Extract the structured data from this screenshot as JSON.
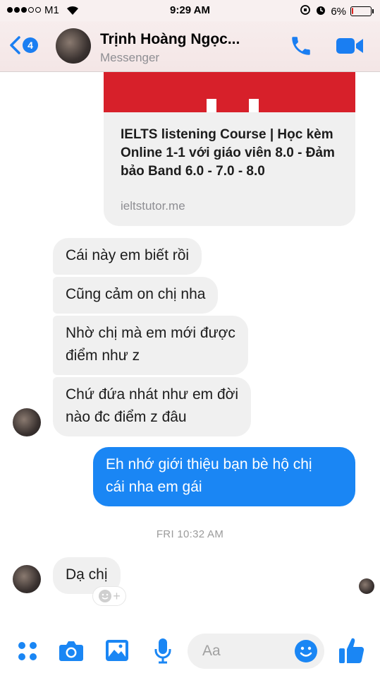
{
  "status_bar": {
    "carrier": "M1",
    "time": "9:29 AM",
    "battery_percent": "6%",
    "battery_level": 0.06,
    "signal_bars_filled": 3,
    "signal_bars_total": 5
  },
  "header": {
    "back_badge": "4",
    "contact_name": "Trịnh Hoàng Ngọc...",
    "subtitle": "Messenger",
    "accent_color": "#1a7ef2"
  },
  "link_card": {
    "title": "IELTS listening Course | Học kèm Online 1-1 với giáo viên 8.0 - Đảm bảo Band 6.0 - 7.0 - 8.0",
    "domain": "ieltstutor.me"
  },
  "messages": [
    {
      "from": "contact",
      "text": "Cái này em biết rồi"
    },
    {
      "from": "contact",
      "text": "Cũng cảm on chị nha"
    },
    {
      "from": "contact",
      "text_line1": "Nhờ chị mà em mới được",
      "text_line2": "điểm như z"
    },
    {
      "from": "contact",
      "text_line1": "Chứ đứa nhát như em đời",
      "text_line2": "nào đc điểm z đâu"
    },
    {
      "from": "me",
      "text_line1": "Eh nhớ giới thiệu bạn bè hộ chị",
      "text_line2": "cái nha em gái"
    },
    {
      "from": "contact",
      "text": "Dạ chị"
    }
  ],
  "timestamp": "FRI 10:32 AM",
  "composer": {
    "placeholder": "Aa",
    "icons": [
      "more-icon",
      "camera-icon",
      "gallery-icon",
      "microphone-icon",
      "emoji-icon",
      "like-icon"
    ]
  },
  "colors": {
    "outgoing_bubble": "#1a86f4",
    "incoming_bubble": "#f0f0f0",
    "card_image": "#d7202a"
  }
}
